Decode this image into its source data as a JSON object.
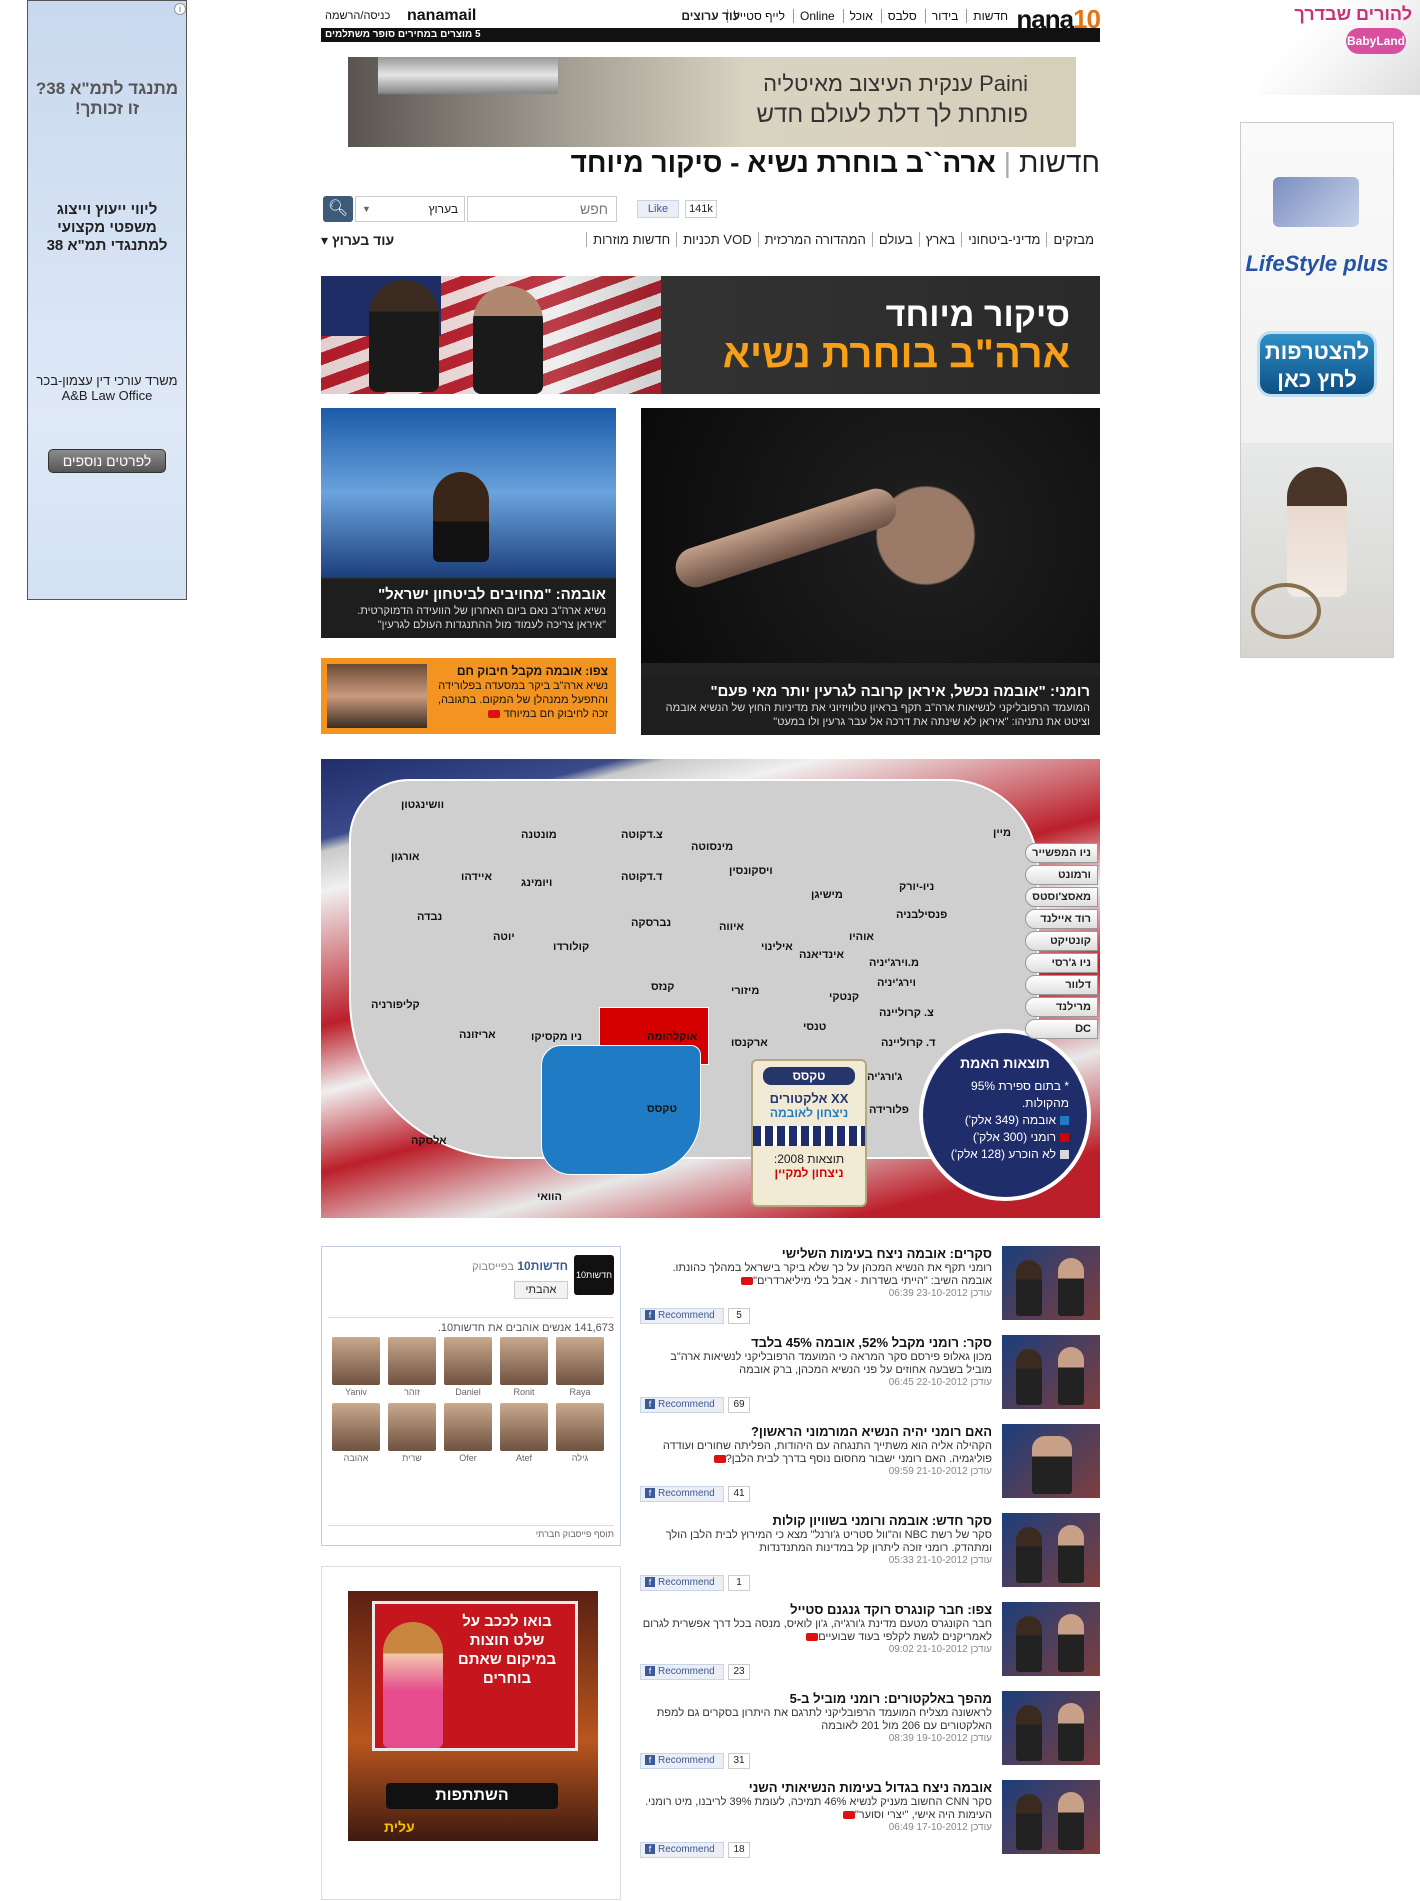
{
  "left_ad": {
    "line1": "מתנגד לתמ\"א 38? זו זכותך!",
    "line2": "ליווי ייעוץ וייצוג משפטי מקצועי למתנגדי תמ\"א 38",
    "line3": "משרד עורכי דין עצמון-בכר A&B Law Office",
    "button": "לפרטים נוספים",
    "corner": "i"
  },
  "babyland": {
    "title": "להורים שבדרך",
    "logo": "BabyLand"
  },
  "right_ad": {
    "brand": "LifeStyle plus",
    "join": "להצטרפות לחץ כאן"
  },
  "header": {
    "logo": "nana",
    "logo_suffix": "10",
    "nav": [
      "חדשות",
      "בידור",
      "סלבס",
      "אוכל",
      "Online",
      "לייף סטייל"
    ],
    "more_sites": "עוד ערוצים",
    "mail": "nanamail",
    "login": "כניסה/הרשמה",
    "promo": "5 מוצרים במחירים סופר משתלמים"
  },
  "top_ad": {
    "line1": "Paini ענקית העיצוב מאיטליה",
    "line2": "פותחת לך דלת לעולם חדש"
  },
  "section": {
    "channel": "חדשות",
    "title": "ארה``ב בוחרת נשיא - סיקור מיוחד"
  },
  "search": {
    "placeholder": "חפש",
    "scope": "בערוץ",
    "button_icon": "search-icon",
    "like": "Like",
    "like_count": "141k"
  },
  "subnav": {
    "items": [
      "מבזקים",
      "מדיני-ביטחוני",
      "בארץ",
      "בעולם",
      "המהדורה המרכזית",
      "VOD תכניות",
      "חדשות מוזרות"
    ],
    "more": "עוד בערוץ"
  },
  "hero": {
    "line1": "סיקור מיוחד",
    "line2": "ארה\"ב בוחרת נשיא"
  },
  "stories": {
    "romney": {
      "headline": "רומני: \"אובמה נכשל, איראן קרובה לגרעין יותר מאי פעם\"",
      "desc": "המועמד הרפובליקני לנשיאות ארה\"ב תקף בראיון טלוויזיוני את מדיניות החוץ של הנשיא אובמה וציטט את נתניהו: \"איראן לא שינתה את דרכה אל עבר גרעין ולו במעט\""
    },
    "obama": {
      "headline": "אובמה: \"מחויבים לביטחון ישראל\"",
      "desc": "נשיא ארה\"ב נאם ביום האחרון של הוועידה הדמוקרטית. \"איראן צריכה לעמוד מול ההתנגדות העולם לגרעין\""
    },
    "video": {
      "headline": "צפו: אובמה מקבל חיבוק חם",
      "desc": "נשיא ארה\"ב ביקר במסעדה בפלורידה והתפעל ממנהלן של המקום. בתגובה, זכה לחיבוק חם במיוחד"
    }
  },
  "map": {
    "states": [
      "וושינגטון",
      "מונטנה",
      "צ.דקוטה",
      "מינסוטה",
      "אורגון",
      "איידהו",
      "ויומינג",
      "ד.דקוטה",
      "ויסקונסין",
      "מישיגן",
      "ניו-יורק",
      "מיין",
      "נבדה",
      "יוטה",
      "קולורדו",
      "נברסקה",
      "איווה",
      "אילינוי",
      "אוהיו",
      "פנסילבניה",
      "קליפורניה",
      "אריזונה",
      "ניו מקסיקו",
      "קנזס",
      "מיזורי",
      "אינדיאנה",
      "מ.וירג'יניה",
      "וירג'יניה",
      "קנטקי",
      "טנסי",
      "צ. קרוליינה",
      "ד. קרוליינה",
      "אוקלהומה",
      "ארקנסו",
      "טקסס",
      "ג'ורג'יה",
      "פלורידה",
      "אלסקה",
      "הוואי"
    ],
    "northeast": [
      "ניו המפשייר",
      "ורמונט",
      "מאסצ'וסטס",
      "רוד איילנד",
      "קונטיקט",
      "ניו ג'רסי",
      "דלוור",
      "מרילנד",
      "DC"
    ],
    "texas_panel": {
      "state": "טקסס",
      "electors": "XX אלקטורים",
      "winner": "ניצחון לאובמה",
      "prev_label": "תוצאות 2008:",
      "prev_winner": "ניצחון למקיין"
    },
    "legend": {
      "title": "תוצאות האמת",
      "note": "* בתום ספירת 95% מהקולות.",
      "rows": [
        {
          "label": "אובמה (349 אלק')",
          "color": "#1f7cc4"
        },
        {
          "label": "רומני (300 אלק')",
          "color": "#d40000"
        },
        {
          "label": "לא הוכרע (128 אלק')",
          "color": "#d8d8d8"
        }
      ]
    }
  },
  "fb_box": {
    "page": "חדשות10",
    "suffix": "בפייסבוק",
    "like": "אהבתי",
    "count": "141,673 אנשים אוהבים את חדשות10.",
    "faces": [
      "Yaniv",
      "זוהר",
      "Daniel",
      "Ronit",
      "Raya",
      "אהובה",
      "שרית",
      "Ofer",
      "Atef",
      "גילה"
    ],
    "plugin": "תוסף פייסבוק חברתי"
  },
  "elite_ad": {
    "headline": "בואו לככב על שלט חוצות במיקום שאתם בוחרים",
    "cta": "השתתפות",
    "brand": "עלית"
  },
  "news": [
    {
      "headline": "סקרים: אובמה ניצח בעימות השלישי",
      "desc": "רומני תקף את הנשיא המכהן על כך שלא ביקר בישראל במהלך כהונתו. אובמה השיב: \"הייתי בשדרות - אבל בלי מיליארדרים\"",
      "time": "עודכן 23-10-2012 06:39",
      "count": "5"
    },
    {
      "headline": "סקר: רומני מקבל 52%, אובמה 45% בלבד",
      "desc": "מכון גאלופ פירסם סקר המראה כי המועמד הרפובליקני לנשיאות ארה\"ב מוביל בשבעה אחוזים על פני הנשיא המכהן, ברק אובמה",
      "time": "עודכן 22-10-2012 06:45",
      "count": "69"
    },
    {
      "headline": "האם רומני יהיה הנשיא המורמוני הראשון?",
      "desc": "הקהילה אליה הוא משתייך התנגחה עם היהודות, הפליתה שחורים ועודדה פוליגמיה. האם רומני ישבור מחסום נוסף בדרך לבית הלבן?",
      "time": "עודכן 21-10-2012 09:59",
      "count": "41"
    },
    {
      "headline": "סקר חדש: אובמה ורומני בשוויון קולות",
      "desc": "סקר של רשת NBC וה\"וול סטריט ג'ורנל\" מצא כי המירוץ לבית הלבן הולך ומתהדק. רומני זוכה ליתרון קל במדינות המתנדנדות",
      "time": "עודכן 21-10-2012 05:33",
      "count": "1"
    },
    {
      "headline": "צפו: חבר קונגרס רוקד גנגנם סטייל",
      "desc": "חבר הקונגרס מטעם מדינת ג'ורג'יה, ג'ון לואיס, מנסה בכל דרך אפשרית לגרום לאמריקנים לגשת לקלפי בעוד שבועיים",
      "time": "עודכן 21-10-2012 09:02",
      "count": "23"
    },
    {
      "headline": "מהפך באלקטורים: רומני מוביל ב-5",
      "desc": "לראשונה מצליח המועמד הרפובליקני לתרגם את היתרון בסקרים גם למפת האלקטורים עם 206 מול 201 לאובמה",
      "time": "עודכן 19-10-2012 08:39",
      "count": "31"
    },
    {
      "headline": "אובמה ניצח בגדול בעימות הנשיאותי השני",
      "desc": "סקר CNN החשוב מעניק לנשיא 46% תמיכה, לעומת 39% לריבנו, מיט רומני. העימות היה אישי, \"יצרי וסוער\"",
      "time": "עודכן 17-10-2012 06:49",
      "count": "18"
    }
  ],
  "recommend_label": "Recommend"
}
